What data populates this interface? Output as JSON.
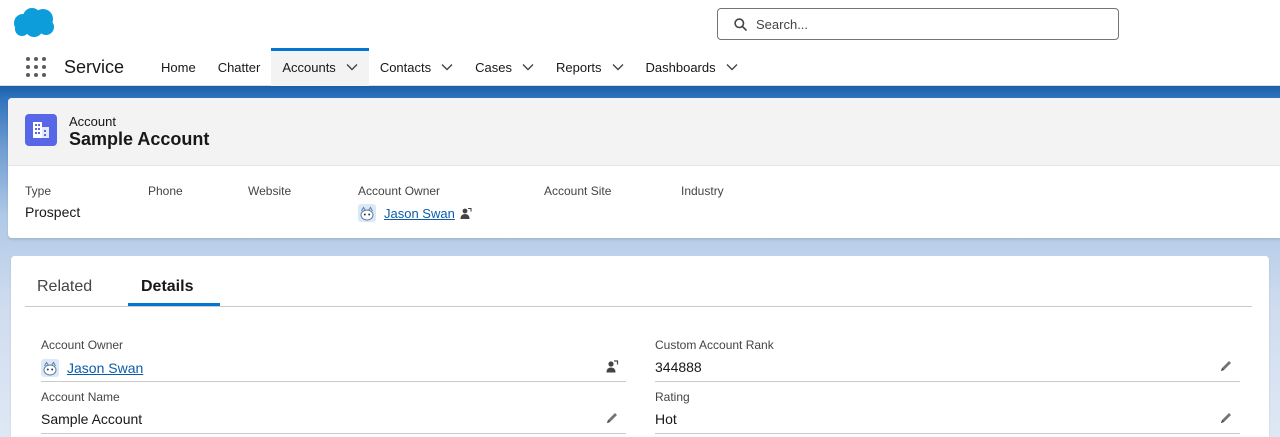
{
  "header": {
    "search_placeholder": "Search..."
  },
  "nav": {
    "app_name": "Service",
    "items": [
      {
        "label": "Home",
        "dropdown": false,
        "active": false
      },
      {
        "label": "Chatter",
        "dropdown": false,
        "active": false
      },
      {
        "label": "Accounts",
        "dropdown": true,
        "active": true
      },
      {
        "label": "Contacts",
        "dropdown": true,
        "active": false
      },
      {
        "label": "Cases",
        "dropdown": true,
        "active": false
      },
      {
        "label": "Reports",
        "dropdown": true,
        "active": false
      },
      {
        "label": "Dashboards",
        "dropdown": true,
        "active": false
      }
    ]
  },
  "record": {
    "object_type": "Account",
    "title": "Sample Account",
    "highlights": {
      "type_label": "Type",
      "type_value": "Prospect",
      "phone_label": "Phone",
      "website_label": "Website",
      "owner_label": "Account Owner",
      "owner_value": "Jason Swan",
      "site_label": "Account Site",
      "industry_label": "Industry"
    }
  },
  "tabs": {
    "related": "Related",
    "details": "Details"
  },
  "details": {
    "owner_label": "Account Owner",
    "owner_value": "Jason Swan",
    "name_label": "Account Name",
    "name_value": "Sample Account",
    "rank_label": "Custom Account Rank",
    "rank_value": "344888",
    "rating_label": "Rating",
    "rating_value": "Hot"
  },
  "colors": {
    "brand_blue": "#0176d3",
    "link": "#0b5cab",
    "account_icon": "#5867e8"
  }
}
